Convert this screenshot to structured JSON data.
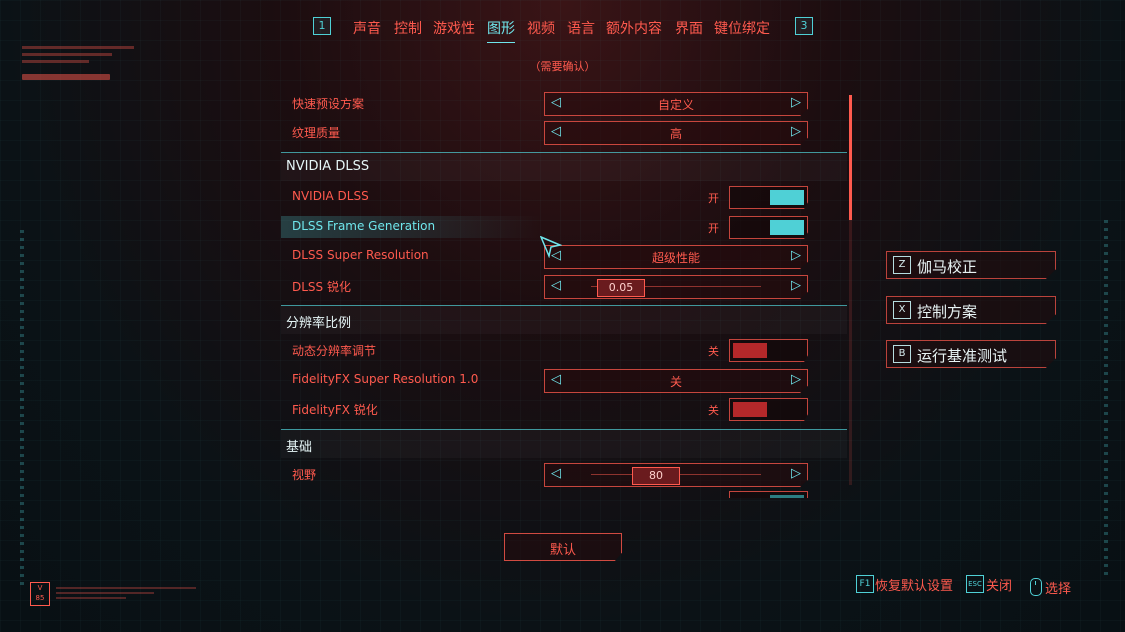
{
  "nav": {
    "left_key": "1",
    "right_key": "3",
    "tabs": [
      {
        "label": "声音"
      },
      {
        "label": "控制"
      },
      {
        "label": "游戏性"
      },
      {
        "label": "图形"
      },
      {
        "label": "视频"
      },
      {
        "label": "语言"
      },
      {
        "label": "额外内容"
      },
      {
        "label": "界面"
      },
      {
        "label": "键位绑定"
      }
    ],
    "active_tab": "图形",
    "note": "（需要确认）"
  },
  "settings": {
    "quick_preset": {
      "label": "快速预设方案",
      "value": "自定义"
    },
    "texture_quality": {
      "label": "纹理质量",
      "value": "高"
    },
    "section_dlss": "NVIDIA DLSS",
    "dlss": {
      "label": "NVIDIA DLSS",
      "state": "开"
    },
    "frame_gen": {
      "label": "DLSS Frame Generation",
      "state": "开"
    },
    "super_res": {
      "label": "DLSS Super Resolution",
      "value": "超级性能"
    },
    "dlss_sharpen": {
      "label": "DLSS 锐化",
      "value": "0.05"
    },
    "section_resolution": "分辨率比例",
    "dynamic_res": {
      "label": "动态分辨率调节",
      "state": "关"
    },
    "fsr": {
      "label": "FidelityFX Super Resolution 1.0",
      "value": "关"
    },
    "fidelity_sharpen": {
      "label": "FidelityFX 锐化",
      "state": "关"
    },
    "section_basic": "基础",
    "fov": {
      "label": "视野",
      "value": "80"
    }
  },
  "side_buttons": [
    {
      "key": "Z",
      "label": "伽马校正"
    },
    {
      "key": "X",
      "label": "控制方案"
    },
    {
      "key": "B",
      "label": "运行基准测试"
    }
  ],
  "default_button": "默认",
  "footer": {
    "restore_key": "F1",
    "restore_label": "恢复默认设置",
    "close_key": "ESC",
    "close_label": "关闭",
    "select_label": "选择"
  },
  "colors": {
    "accent_red": "#ff5a4e",
    "accent_cyan": "#4fd0d6"
  }
}
